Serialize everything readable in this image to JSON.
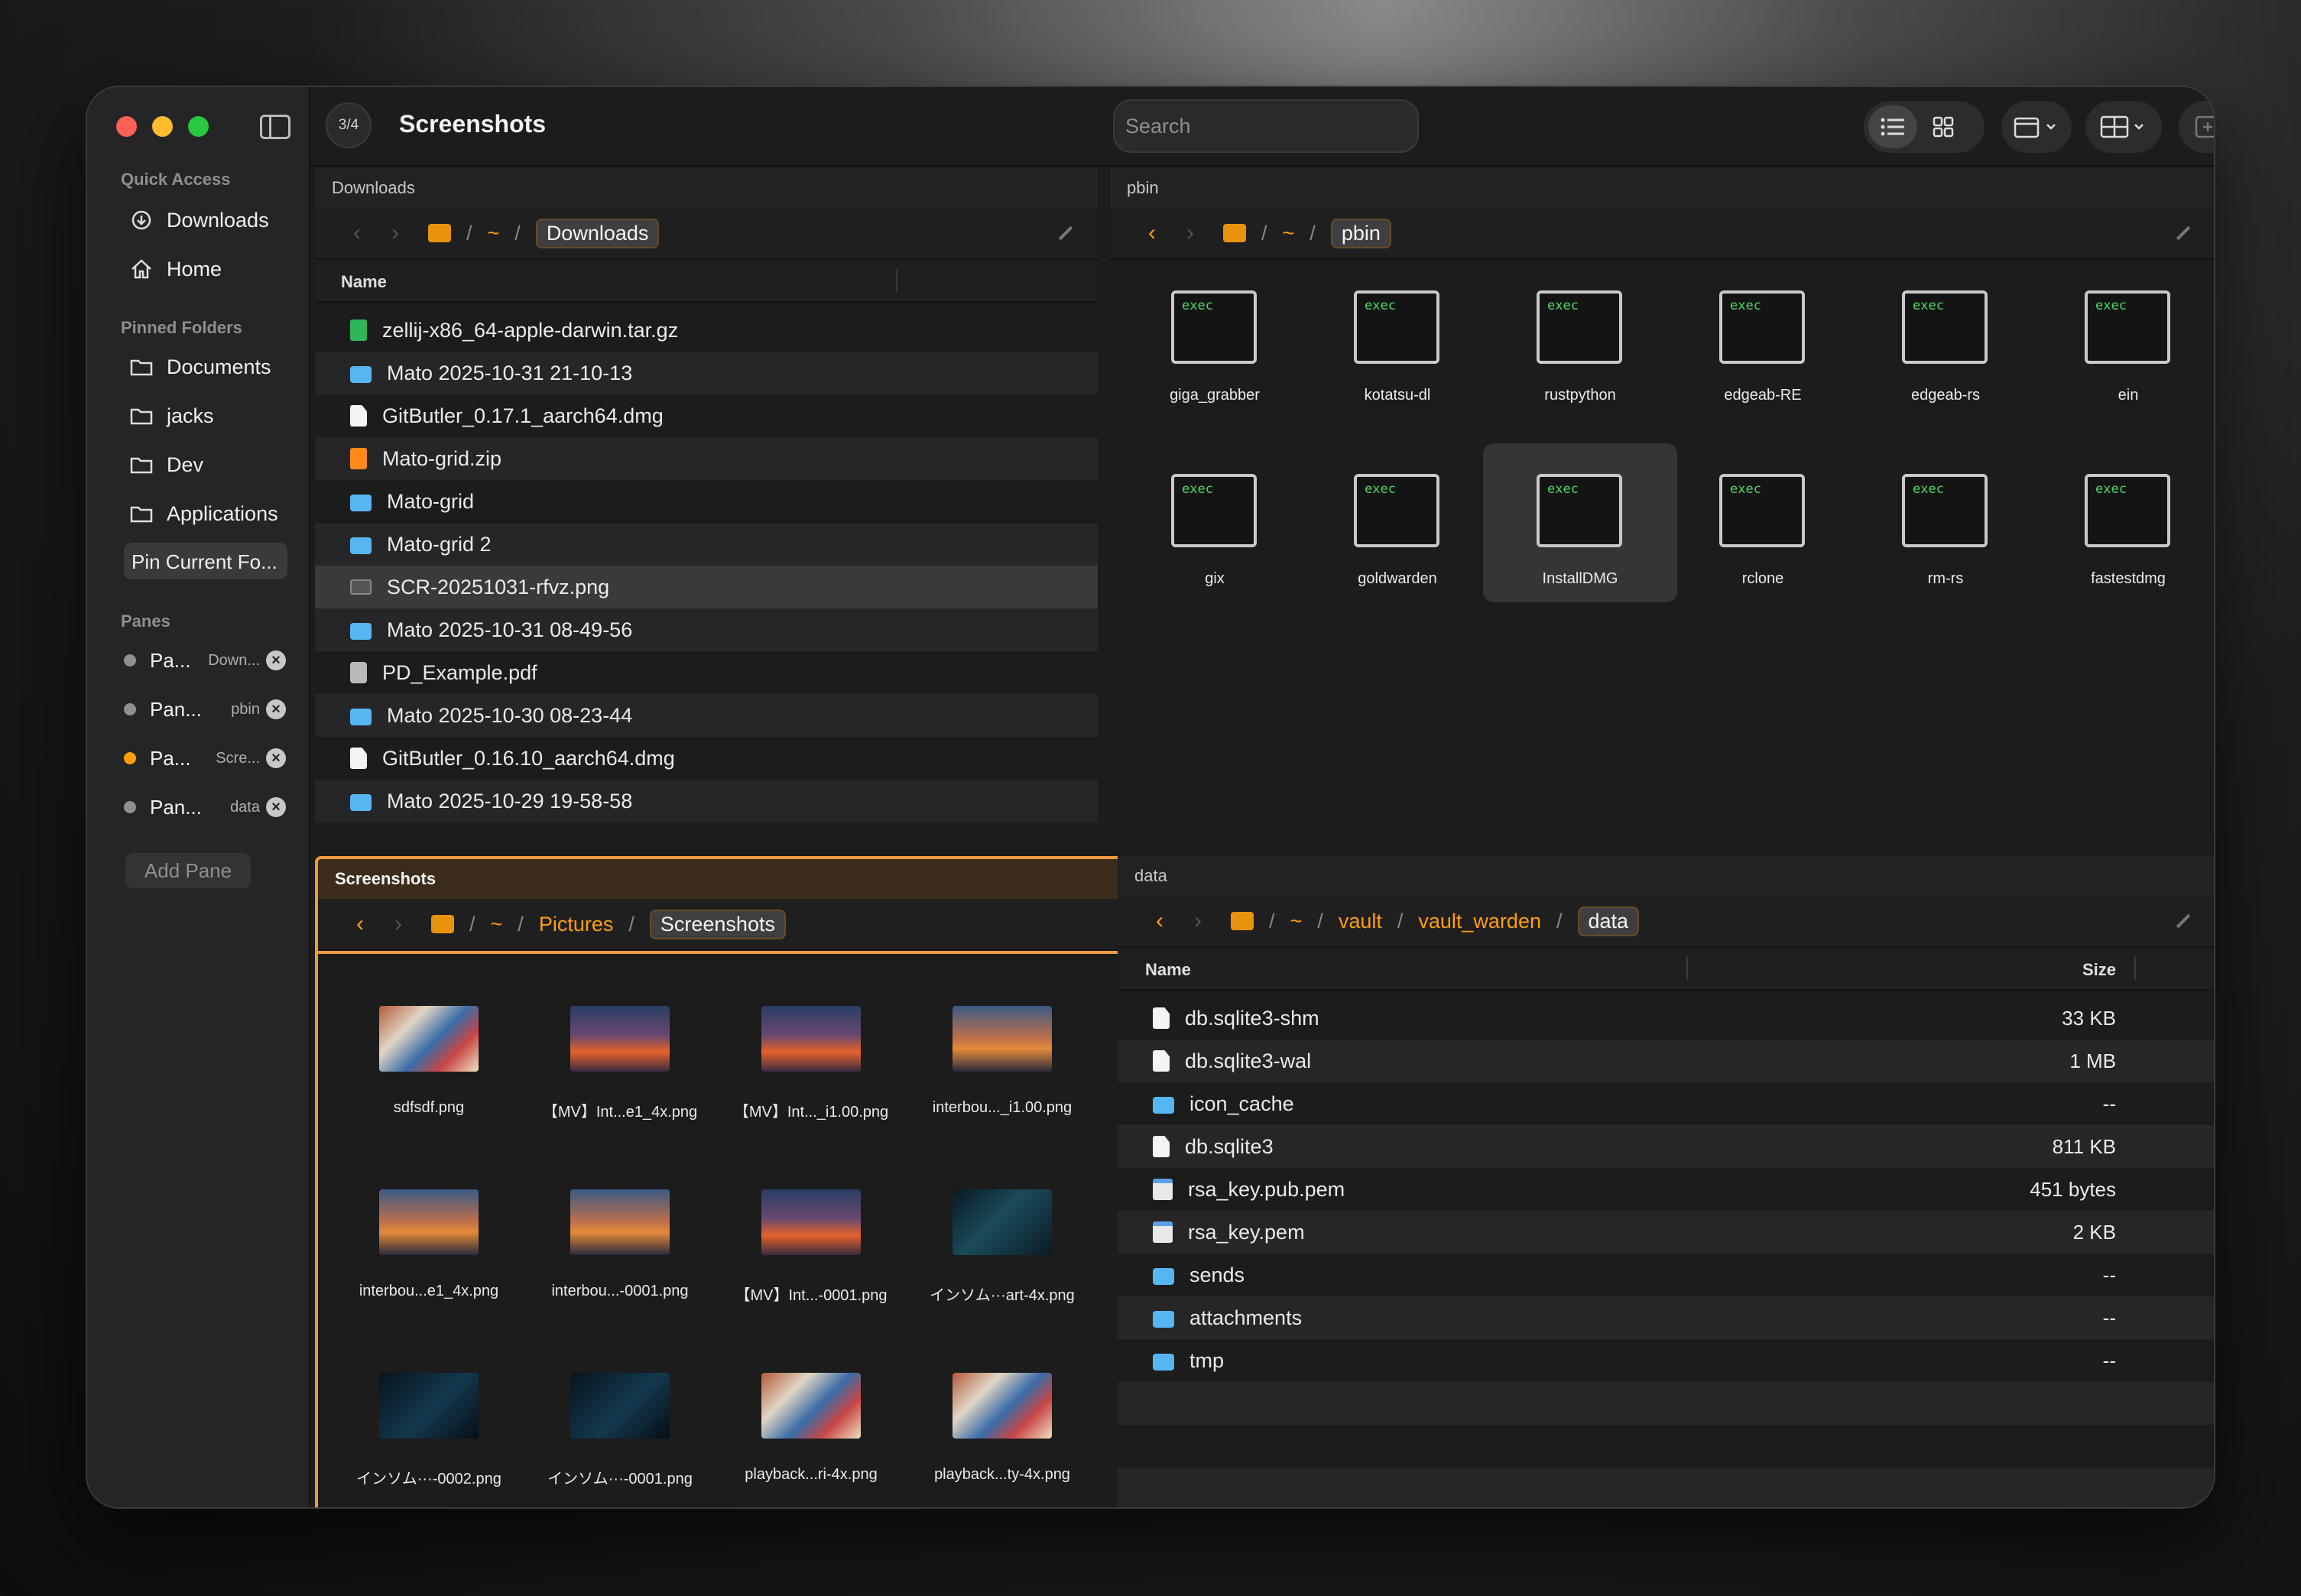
{
  "window": {
    "counter": "3/4",
    "title": "Screenshots",
    "search_placeholder": "Search"
  },
  "sidebar": {
    "quick_access_label": "Quick Access",
    "quick_access": [
      {
        "label": "Downloads",
        "icon": "download-icon"
      },
      {
        "label": "Home",
        "icon": "home-icon"
      }
    ],
    "pinned_label": "Pinned Folders",
    "pinned": [
      {
        "label": "Documents",
        "icon": "folder-icon"
      },
      {
        "label": "jacks",
        "icon": "folder-icon"
      },
      {
        "label": "Dev",
        "icon": "folder-icon"
      },
      {
        "label": "Applications",
        "icon": "folder-icon"
      }
    ],
    "pin_button": "Pin Current Fo...",
    "panes_label": "Panes",
    "panes": [
      {
        "name": "Pa...",
        "location": "Down...",
        "active": false
      },
      {
        "name": "Pan...",
        "location": "pbin",
        "active": false
      },
      {
        "name": "Pa...",
        "location": "Scre...",
        "active": true
      },
      {
        "name": "Pan...",
        "location": "data",
        "active": false
      }
    ],
    "add_pane": "Add Pane"
  },
  "panes": {
    "downloads": {
      "title": "Downloads",
      "path": [
        "~",
        "Downloads"
      ],
      "col_name": "Name",
      "files": [
        {
          "name": "zellij-x86_64-apple-darwin.tar.gz",
          "type": "gz"
        },
        {
          "name": "Mato 2025-10-31 21-10-13",
          "type": "folder"
        },
        {
          "name": "GitButler_0.17.1_aarch64.dmg",
          "type": "doc"
        },
        {
          "name": "Mato-grid.zip",
          "type": "zip"
        },
        {
          "name": "Mato-grid",
          "type": "folder"
        },
        {
          "name": "Mato-grid 2",
          "type": "folder"
        },
        {
          "name": "SCR-20251031-rfvz.png",
          "type": "img",
          "highlight": true
        },
        {
          "name": "Mato 2025-10-31 08-49-56",
          "type": "folder"
        },
        {
          "name": "PD_Example.pdf",
          "type": "pdf"
        },
        {
          "name": "Mato 2025-10-30 08-23-44",
          "type": "folder"
        },
        {
          "name": "GitButler_0.16.10_aarch64.dmg",
          "type": "doc"
        },
        {
          "name": "Mato 2025-10-29 19-58-58",
          "type": "folder"
        }
      ]
    },
    "pbin": {
      "title": "pbin",
      "path": [
        "~",
        "pbin"
      ],
      "exec_label": "exec",
      "items": [
        "giga_grabber",
        "kotatsu-dl",
        "rustpython",
        "edgeab-RE",
        "edgeab-rs",
        "ein",
        "gix",
        "goldwarden",
        "InstallDMG",
        "rclone",
        "rm-rs",
        "fastestdmg"
      ],
      "selected": "InstallDMG"
    },
    "screenshots": {
      "title": "Screenshots",
      "path": [
        "~",
        "Pictures",
        "Screenshots"
      ],
      "items": [
        {
          "name": "sdfsdf.png",
          "thumb": "festival"
        },
        {
          "name": "【MV】Int...e1_4x.png",
          "thumb": "city"
        },
        {
          "name": "【MV】Int..._i1.00.png",
          "thumb": "city"
        },
        {
          "name": "interbou..._i1.00.png",
          "thumb": "road"
        },
        {
          "name": "interbou...e1_4x.png",
          "thumb": "road"
        },
        {
          "name": "interbou...-0001.png",
          "thumb": "road"
        },
        {
          "name": "【MV】Int...-0001.png",
          "thumb": "city"
        },
        {
          "name": "インソム···art-4x.png",
          "thumb": "dark"
        },
        {
          "name": "インソム···-0002.png",
          "thumb": "night"
        },
        {
          "name": "インソム···-0001.png",
          "thumb": "night"
        },
        {
          "name": "playback...ri-4x.png",
          "thumb": "festival"
        },
        {
          "name": "playback...ty-4x.png",
          "thumb": "festival"
        }
      ]
    },
    "data": {
      "title": "data",
      "path": [
        "~",
        "vault",
        "vault_warden",
        "data"
      ],
      "col_name": "Name",
      "col_size": "Size",
      "files": [
        {
          "name": "db.sqlite3-shm",
          "size": "33 KB",
          "type": "doc"
        },
        {
          "name": "db.sqlite3-wal",
          "size": "1 MB",
          "type": "doc"
        },
        {
          "name": "icon_cache",
          "size": "--",
          "type": "folder"
        },
        {
          "name": "db.sqlite3",
          "size": "811 KB",
          "type": "doc"
        },
        {
          "name": "rsa_key.pub.pem",
          "size": "451 bytes",
          "type": "pem"
        },
        {
          "name": "rsa_key.pem",
          "size": "2 KB",
          "type": "pem"
        },
        {
          "name": "sends",
          "size": "--",
          "type": "folder"
        },
        {
          "name": "attachments",
          "size": "--",
          "type": "folder"
        },
        {
          "name": "tmp",
          "size": "--",
          "type": "folder"
        }
      ]
    }
  },
  "colors": {
    "accent": "#ff9f0a",
    "folder": "#56b6f2",
    "exec_text": "#4cd964"
  }
}
